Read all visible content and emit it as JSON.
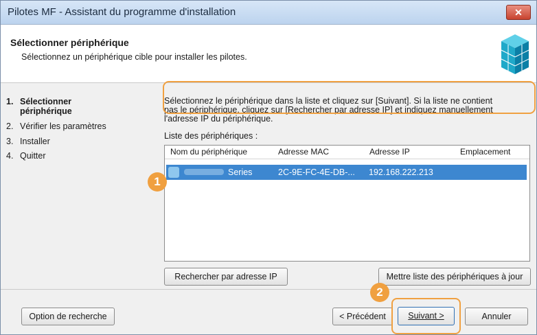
{
  "window": {
    "title": "Pilotes MF - Assistant du programme d'installation",
    "close_glyph": "✕"
  },
  "header": {
    "title": "Sélectionner périphérique",
    "subtitle": "Sélectionnez un périphérique cible pour installer les pilotes.",
    "icon": "cube-icon"
  },
  "steps": [
    {
      "num": "1.",
      "label_line1": "Sélectionner",
      "label_line2": "périphérique"
    },
    {
      "num": "2.",
      "label": "Vérifier les paramètres"
    },
    {
      "num": "3.",
      "label": "Installer"
    },
    {
      "num": "4.",
      "label": "Quitter"
    }
  ],
  "main": {
    "instructions_line1": "Sélectionnez le périphérique dans la liste et cliquez sur [Suivant]. Si la liste ne contient",
    "instructions_line2": "pas le périphérique, cliquez sur [Rechercher par adresse IP] et indiquez manuellement",
    "instructions_line3": "l'adresse IP du périphérique.",
    "list_label": "Liste des périphériques :",
    "columns": [
      "Nom du périphérique",
      "Adresse MAC",
      "Adresse IP",
      "Emplacement"
    ],
    "device": {
      "name": "Series",
      "mac": "2C-9E-FC-4E-DB-...",
      "ip": "192.168.222.213"
    }
  },
  "buttons": {
    "search_ip": "Rechercher par adresse IP",
    "refresh_list": "Mettre liste des périphériques à jour",
    "search_options": "Option de recherche",
    "previous": "< Précédent",
    "next": "Suivant >",
    "cancel": "Annuler"
  },
  "callouts": {
    "one": "1",
    "two": "2"
  },
  "colors": {
    "highlight": "#f0a040",
    "selection": "#3d87d0"
  }
}
